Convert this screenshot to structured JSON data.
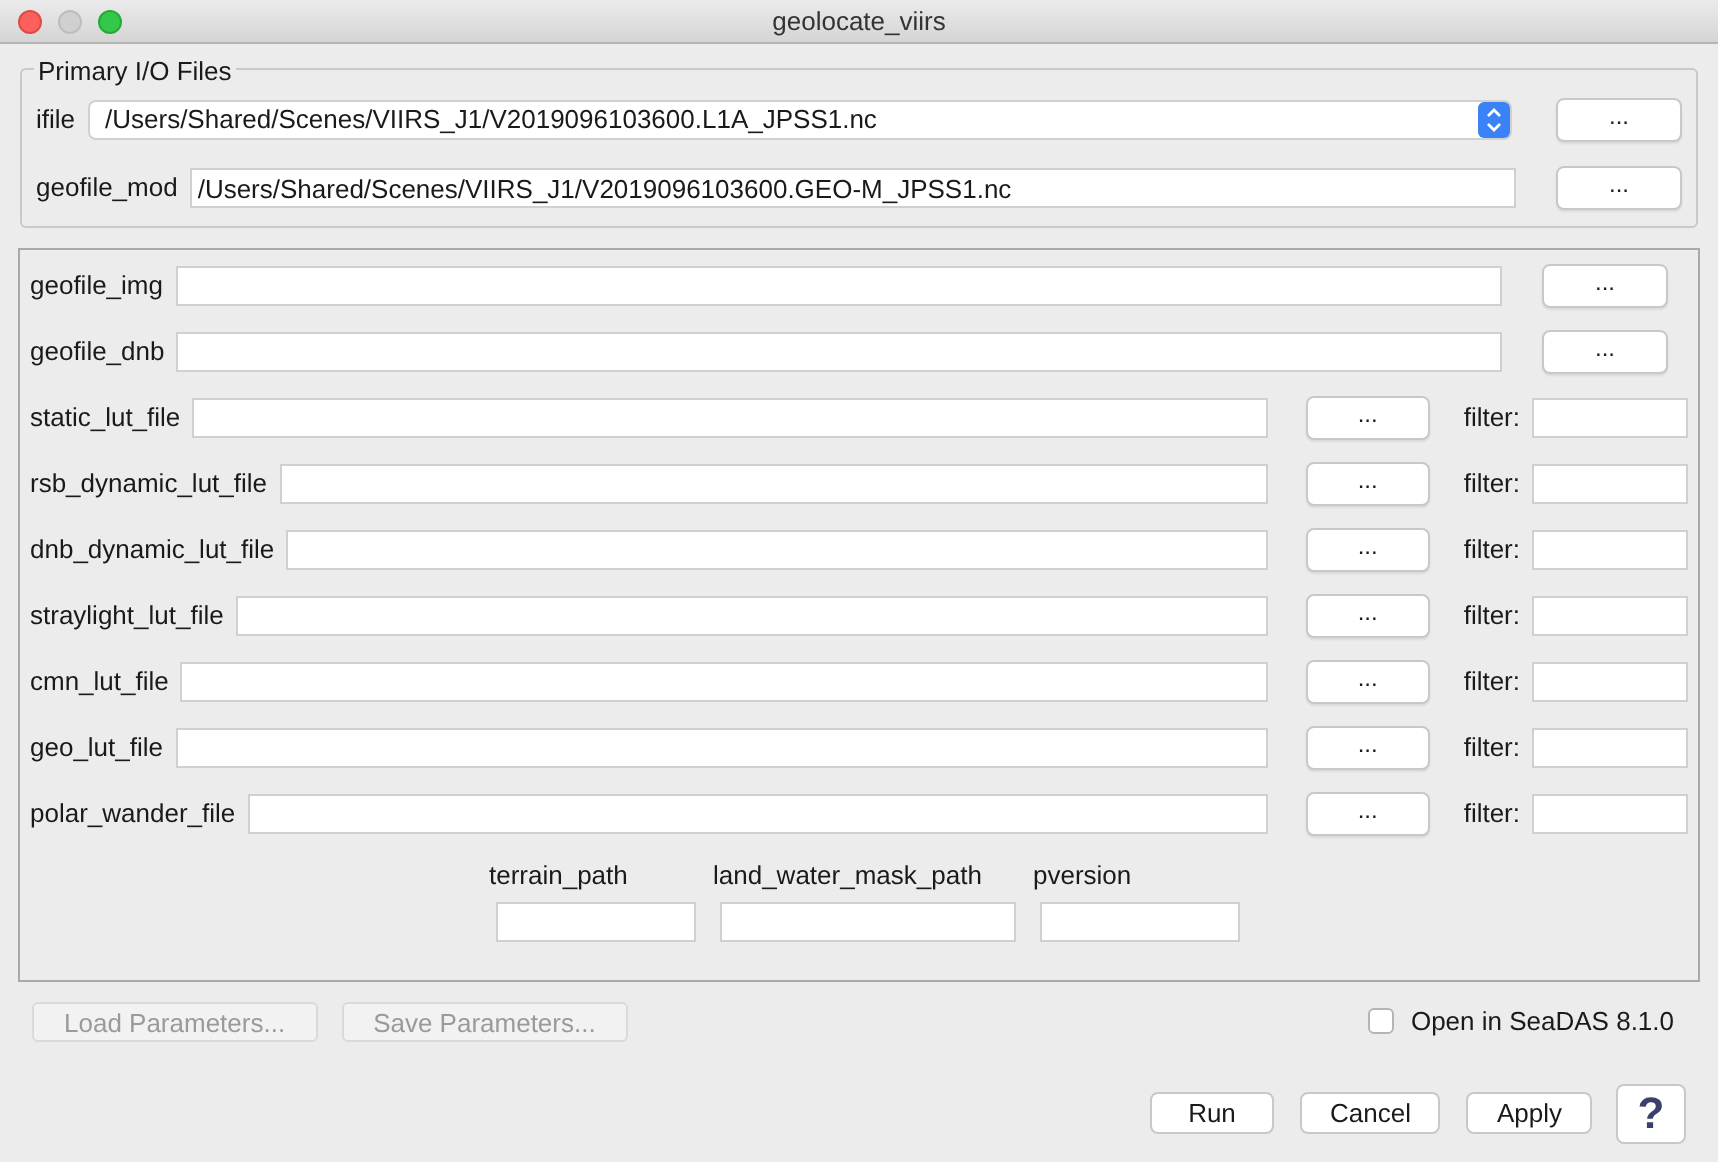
{
  "window": {
    "title": "geolocate_viirs"
  },
  "primary": {
    "title": "Primary I/O Files",
    "rows": [
      {
        "kind": "combo",
        "label": "ifile",
        "value": "/Users/Shared/Scenes/VIIRS_J1/V2019096103600.L1A_JPSS1.nc",
        "button": "..."
      },
      {
        "kind": "text",
        "label": "geofile_mod",
        "value": "/Users/Shared/Scenes/VIIRS_J1/V2019096103600.GEO-M_JPSS1.nc",
        "button": "..."
      }
    ]
  },
  "fields": [
    {
      "kind": "file",
      "label": "geofile_img",
      "button": "..."
    },
    {
      "kind": "file",
      "label": "geofile_dnb",
      "button": "..."
    },
    {
      "kind": "filtered",
      "label": "static_lut_file",
      "button": "...",
      "filter": "filter:"
    },
    {
      "kind": "filtered",
      "label": "rsb_dynamic_lut_file",
      "button": "...",
      "filter": "filter:"
    },
    {
      "kind": "filtered",
      "label": "dnb_dynamic_lut_file",
      "button": "...",
      "filter": "filter:"
    },
    {
      "kind": "filtered",
      "label": "straylight_lut_file",
      "button": "...",
      "filter": "filter:"
    },
    {
      "kind": "filtered",
      "label": "cmn_lut_file",
      "button": "...",
      "filter": "filter:"
    },
    {
      "kind": "filtered",
      "label": "geo_lut_file",
      "button": "...",
      "filter": "filter:"
    },
    {
      "kind": "filtered",
      "label": "polar_wander_file",
      "button": "...",
      "filter": "filter:"
    }
  ],
  "small_fields": [
    {
      "label": "terrain_path"
    },
    {
      "label": "land_water_mask_path"
    },
    {
      "label": "pversion"
    }
  ],
  "param_buttons": [
    {
      "label": "Load Parameters...",
      "disabled": true
    },
    {
      "label": "Save Parameters...",
      "disabled": true
    }
  ],
  "open_in": {
    "label": "Open in SeaDAS 8.1.0",
    "checked": false
  },
  "actions": [
    "Run",
    "Cancel",
    "Apply"
  ],
  "help": "?"
}
